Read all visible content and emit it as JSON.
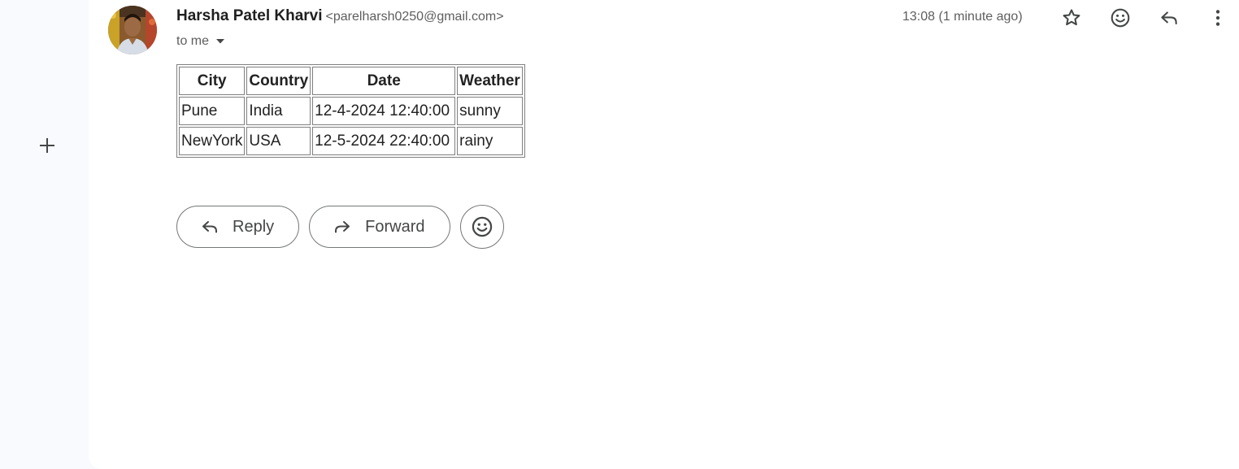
{
  "sender": {
    "name": "Harsha Patel Kharvi",
    "email": "<parelharsh0250@gmail.com>",
    "recipient_label": "to me",
    "avatar_icon": "profile-photo"
  },
  "timestamp": "13:08 (1 minute ago)",
  "header_icons": [
    "star-icon",
    "emoji-icon",
    "reply-icon",
    "more-vert-icon"
  ],
  "table": {
    "headers": [
      "City",
      "Country",
      "Date",
      "Weather"
    ],
    "rows": [
      [
        "Pune",
        "India",
        "12-4-2024 12:40:00",
        "sunny"
      ],
      [
        "NewYork",
        "USA",
        "12-5-2024 22:40:00",
        "rainy"
      ]
    ]
  },
  "actions": {
    "reply_label": "Reply",
    "forward_label": "Forward"
  },
  "colors": {
    "rail_bg": "#f8fafd",
    "text_primary": "#1f1f1f",
    "text_secondary": "#5e5e5e",
    "icon": "#444746"
  }
}
